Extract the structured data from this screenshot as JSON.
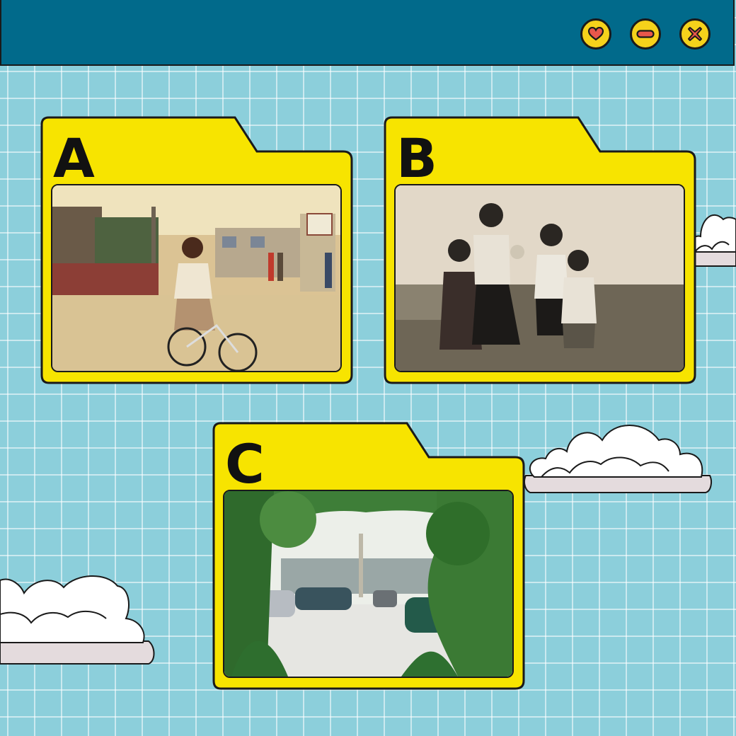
{
  "window": {
    "buttons": [
      {
        "icon": "heart-icon"
      },
      {
        "icon": "minus-icon"
      },
      {
        "icon": "close-icon"
      }
    ]
  },
  "folders": [
    {
      "label": "A"
    },
    {
      "label": "B"
    },
    {
      "label": "C"
    }
  ],
  "colors": {
    "titlebar": "#016a8b",
    "background": "#8ccfdb",
    "folder": "#f7e400",
    "button": "#f5d21b",
    "icon": "#e8574b",
    "outline": "#1a1a1a"
  }
}
